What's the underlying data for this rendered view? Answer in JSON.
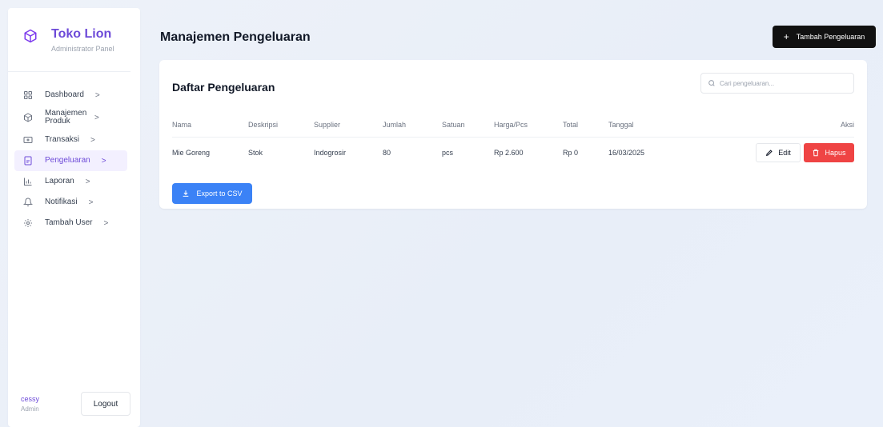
{
  "brand": {
    "title": "Toko Lion",
    "subtitle": "Administrator Panel",
    "icon": "box-icon",
    "accent": "#6d4ad8"
  },
  "sidebar": {
    "items": [
      {
        "label": "Dashboard",
        "icon": "grid-icon"
      },
      {
        "label": "Manajemen Produk",
        "icon": "box-icon"
      },
      {
        "label": "Transaksi",
        "icon": "card-icon"
      },
      {
        "label": "Pengeluaran",
        "icon": "document-icon",
        "active": true
      },
      {
        "label": "Laporan",
        "icon": "bar-chart-icon"
      },
      {
        "label": "Notifikasi",
        "icon": "bell-icon"
      },
      {
        "label": "Tambah User",
        "icon": "gear-icon"
      }
    ],
    "chevron": ">"
  },
  "user": {
    "name": "cessy",
    "role": "Admin",
    "logout_label": "Logout"
  },
  "header": {
    "title": "Manajemen Pengeluaran",
    "add_button_label": "Tambah Pengeluaran",
    "add_button_icon": "+"
  },
  "card": {
    "title": "Daftar Pengeluaran",
    "search_placeholder": "Cari pengeluaran..."
  },
  "table": {
    "columns": [
      "Nama",
      "Deskripsi",
      "Supplier",
      "Jumlah",
      "Satuan",
      "Harga/Pcs",
      "Total",
      "Tanggal",
      "Aksi"
    ],
    "rows": [
      {
        "nama": "Mie Goreng",
        "deskripsi": "Stok",
        "supplier": "Indogrosir",
        "jumlah": "80",
        "satuan": "pcs",
        "harga": "Rp 2.600",
        "total": "Rp 0",
        "tanggal": "16/03/2025"
      }
    ],
    "edit_label": "Edit",
    "delete_label": "Hapus"
  },
  "export_label": "Export to CSV",
  "colors": {
    "primary": "#6d4ad8",
    "danger": "#ef4444",
    "info": "#3b82f6",
    "dark": "#111111"
  }
}
